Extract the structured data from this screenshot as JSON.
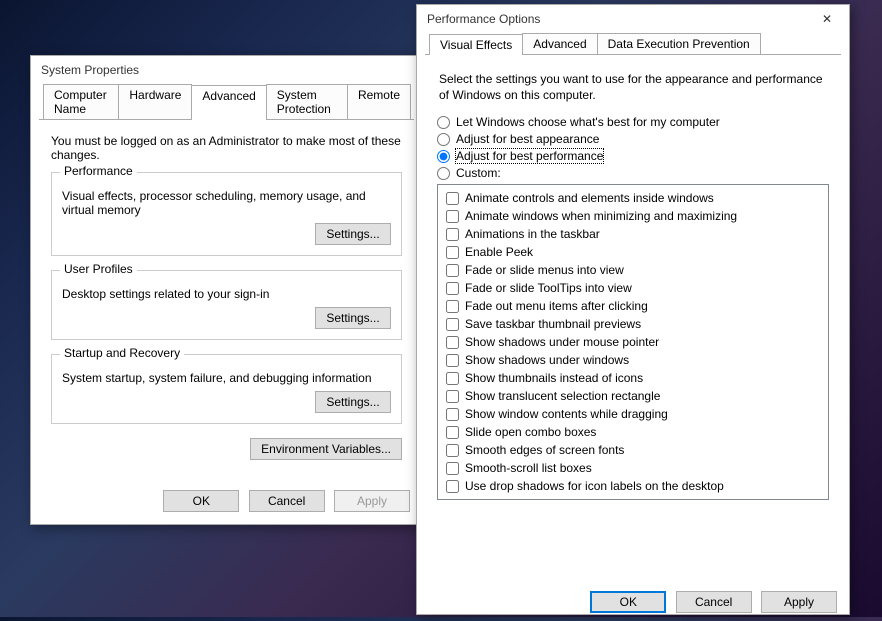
{
  "sysprops": {
    "title": "System Properties",
    "tabs": [
      "Computer Name",
      "Hardware",
      "Advanced",
      "System Protection",
      "Remote"
    ],
    "active_tab": 2,
    "admin_note": "You must be logged on as an Administrator to make most of these changes.",
    "groups": {
      "perf": {
        "legend": "Performance",
        "desc": "Visual effects, processor scheduling, memory usage, and virtual memory",
        "button": "Settings..."
      },
      "profiles": {
        "legend": "User Profiles",
        "desc": "Desktop settings related to your sign-in",
        "button": "Settings..."
      },
      "startup": {
        "legend": "Startup and Recovery",
        "desc": "System startup, system failure, and debugging information",
        "button": "Settings..."
      }
    },
    "env_button": "Environment Variables...",
    "buttons": {
      "ok": "OK",
      "cancel": "Cancel",
      "apply": "Apply"
    }
  },
  "perfopts": {
    "title": "Performance Options",
    "tabs": [
      "Visual Effects",
      "Advanced",
      "Data Execution Prevention"
    ],
    "active_tab": 0,
    "intro": "Select the settings you want to use for the appearance and performance of Windows on this computer.",
    "radios": [
      "Let Windows choose what's best for my computer",
      "Adjust for best appearance",
      "Adjust for best performance",
      "Custom:"
    ],
    "selected_radio": 2,
    "checks": [
      "Animate controls and elements inside windows",
      "Animate windows when minimizing and maximizing",
      "Animations in the taskbar",
      "Enable Peek",
      "Fade or slide menus into view",
      "Fade or slide ToolTips into view",
      "Fade out menu items after clicking",
      "Save taskbar thumbnail previews",
      "Show shadows under mouse pointer",
      "Show shadows under windows",
      "Show thumbnails instead of icons",
      "Show translucent selection rectangle",
      "Show window contents while dragging",
      "Slide open combo boxes",
      "Smooth edges of screen fonts",
      "Smooth-scroll list boxes",
      "Use drop shadows for icon labels on the desktop"
    ],
    "buttons": {
      "ok": "OK",
      "cancel": "Cancel",
      "apply": "Apply"
    }
  }
}
